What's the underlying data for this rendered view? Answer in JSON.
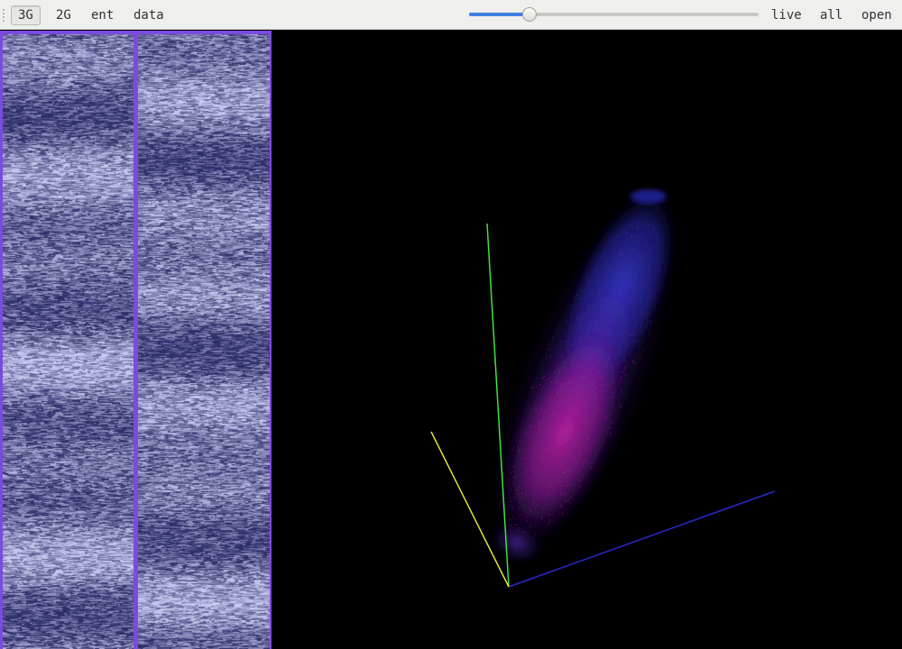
{
  "toolbar": {
    "buttons": [
      {
        "label": "3G",
        "active": true
      },
      {
        "label": "2G",
        "active": false
      },
      {
        "label": "ent",
        "active": false
      },
      {
        "label": "data",
        "active": false
      }
    ],
    "slider": {
      "value": 0.21
    },
    "right_buttons": [
      {
        "label": "live"
      },
      {
        "label": "all"
      },
      {
        "label": "open"
      }
    ]
  },
  "colors": {
    "accent": "#3f7fe0",
    "panel_border": "#7b4be0",
    "strip_dark": "#2e2e6a",
    "strip_light": "#c8c8f0",
    "axis_x": "#2a2ad0",
    "axis_y": "#3ee23e",
    "axis_z": "#e6e634",
    "cloud_blue": "#3535c8",
    "cloud_magenta": "#c21e9e"
  },
  "icons": {
    "grip": "toolbar-grip-icon"
  }
}
